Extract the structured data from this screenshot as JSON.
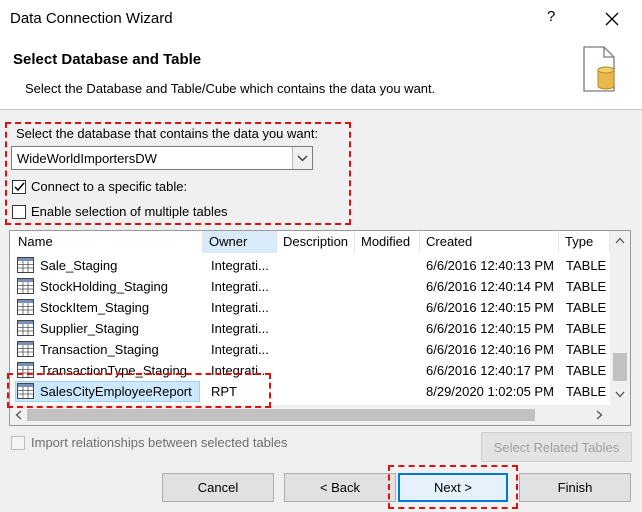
{
  "window": {
    "title": "Data Connection Wizard",
    "help": "?"
  },
  "header": {
    "title": "Select Database and Table",
    "subtitle": "Select the Database and Table/Cube which contains the data you want."
  },
  "database": {
    "label": "Select the database that contains the data you want:",
    "selected": "WideWorldImportersDW"
  },
  "options": {
    "connect_label": "Connect to a specific table:",
    "connect_checked": true,
    "multi_label": "Enable selection of multiple tables",
    "multi_checked": false
  },
  "table_list": {
    "columns": [
      "Name",
      "Owner",
      "Description",
      "Modified",
      "Created",
      "Type"
    ],
    "rows": [
      {
        "name": "Sale_Staging",
        "owner": "Integrati...",
        "description": "",
        "modified": "",
        "created": "6/6/2016 12:40:13 PM",
        "type": "TABLE"
      },
      {
        "name": "StockHolding_Staging",
        "owner": "Integrati...",
        "description": "",
        "modified": "",
        "created": "6/6/2016 12:40:14 PM",
        "type": "TABLE"
      },
      {
        "name": "StockItem_Staging",
        "owner": "Integrati...",
        "description": "",
        "modified": "",
        "created": "6/6/2016 12:40:15 PM",
        "type": "TABLE"
      },
      {
        "name": "Supplier_Staging",
        "owner": "Integrati...",
        "description": "",
        "modified": "",
        "created": "6/6/2016 12:40:15 PM",
        "type": "TABLE"
      },
      {
        "name": "Transaction_Staging",
        "owner": "Integrati...",
        "description": "",
        "modified": "",
        "created": "6/6/2016 12:40:16 PM",
        "type": "TABLE"
      },
      {
        "name": "TransactionType_Staging",
        "owner": "Integrati...",
        "description": "",
        "modified": "",
        "created": "6/6/2016 12:40:17 PM",
        "type": "TABLE"
      },
      {
        "name": "SalesCityEmployeeReport",
        "owner": "RPT",
        "description": "",
        "modified": "",
        "created": "8/29/2020 1:02:05 PM",
        "type": "TABLE"
      }
    ],
    "selected_row": "SalesCityEmployeeReport"
  },
  "import": {
    "label": "Import relationships between selected tables",
    "related_button": "Select Related Tables"
  },
  "buttons": {
    "cancel": "Cancel",
    "back": "< Back",
    "next": "Next >",
    "finish": "Finish"
  },
  "colors": {
    "highlight_dash": "#e01010",
    "selection": "#cce8ff",
    "focus_border": "#0078d7"
  }
}
